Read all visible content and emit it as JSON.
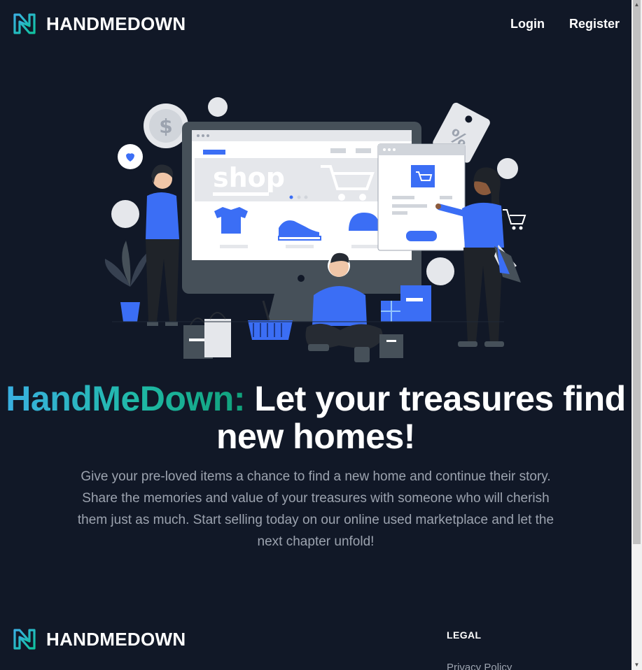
{
  "header": {
    "brand": "HANDMEDOWN",
    "nav": {
      "login": "Login",
      "register": "Register"
    }
  },
  "illustration": {
    "screen_text": "shop",
    "tag_text": "%"
  },
  "hero": {
    "headline_brand": "HandMeDown:",
    "headline_rest": "Let your treasures find new homes!",
    "description": "Give your pre-loved items a chance to find a new home and continue their story. Share the memories and value of your treasures with someone who will cherish them just as much. Start selling today on our online used marketplace and let the next chapter unfold!"
  },
  "footer": {
    "brand": "HANDMEDOWN",
    "legal_title": "LEGAL",
    "legal_link": "Privacy Policy"
  },
  "colors": {
    "background": "#111827",
    "accent_blue": "#3b6ef5",
    "logo_gradient_start": "#3ab0e2",
    "logo_gradient_end": "#10a17a"
  }
}
